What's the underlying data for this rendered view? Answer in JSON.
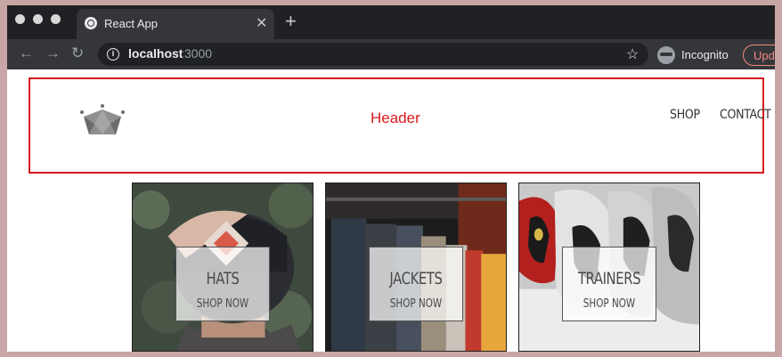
{
  "browser": {
    "tab_title": "React App",
    "url_host": "localhost",
    "url_port": ":3000",
    "incognito_label": "Incognito",
    "update_label": "Upd"
  },
  "header": {
    "label": "Header",
    "nav": [
      {
        "label": "SHOP"
      },
      {
        "label": "CONTACT"
      }
    ],
    "accent_color": "#d7191c"
  },
  "categories": [
    {
      "title": "HATS",
      "subtitle": "SHOP NOW",
      "image": "person-wearing-cap"
    },
    {
      "title": "JACKETS",
      "subtitle": "SHOP NOW",
      "image": "clothes-rack"
    },
    {
      "title": "TRAINERS",
      "subtitle": "SHOP NOW",
      "image": "sneakers"
    }
  ]
}
